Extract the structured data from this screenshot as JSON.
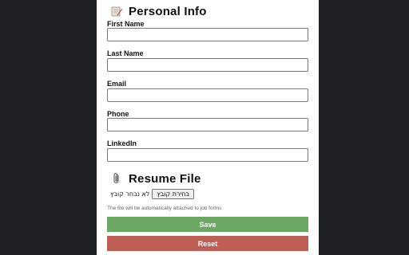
{
  "personal": {
    "title": "Personal Info",
    "icon": "notepad-pencil-icon",
    "fields": [
      {
        "label": "First Name",
        "value": ""
      },
      {
        "label": "Last Name",
        "value": ""
      },
      {
        "label": "Email",
        "value": ""
      },
      {
        "label": "Phone",
        "value": ""
      },
      {
        "label": "LinkedIn",
        "value": ""
      }
    ]
  },
  "resume": {
    "title": "Resume File",
    "icon": "paperclip-icon",
    "choose_button": "בחירת קובץ",
    "file_status": "לא נבחר קובץ",
    "note": "The file will be automatically attached to job forms"
  },
  "actions": {
    "save_label": "Save",
    "save_color": "#6aa864",
    "reset_label": "Reset",
    "reset_color": "#bf5f54"
  },
  "colors": {
    "background": "#202124",
    "panel": "#ffffff"
  }
}
